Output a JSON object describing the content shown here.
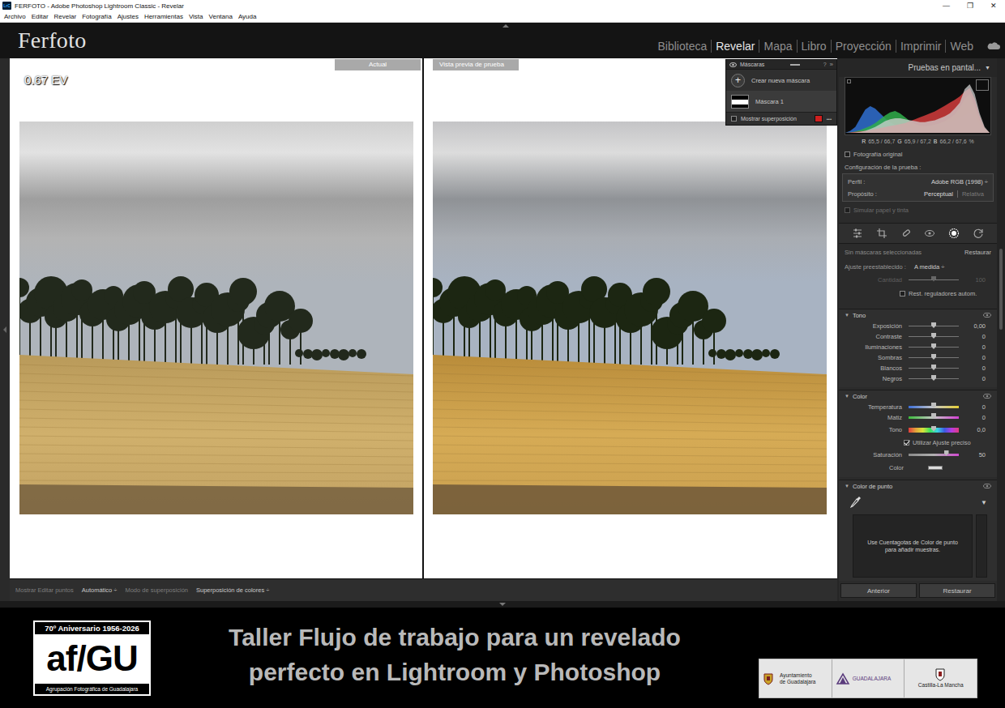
{
  "window": {
    "app_icon": "LrC",
    "title": "FERFOTO - Adobe Photoshop Lightroom Classic - Revelar",
    "controls": [
      "—",
      "❐",
      "✕"
    ]
  },
  "menu": [
    "Archivo",
    "Editar",
    "Revelar",
    "Fotografía",
    "Ajustes",
    "Herramientas",
    "Vista",
    "Ventana",
    "Ayuda"
  ],
  "identity_plate": "Ferfoto",
  "modules": [
    {
      "label": "Biblioteca",
      "selected": false
    },
    {
      "label": "Revelar",
      "selected": true
    },
    {
      "label": "Mapa",
      "selected": false
    },
    {
      "label": "Libro",
      "selected": false
    },
    {
      "label": "Proyección",
      "selected": false
    },
    {
      "label": "Imprimir",
      "selected": false
    },
    {
      "label": "Web",
      "selected": false
    }
  ],
  "compare": {
    "exposure_overlay": "0.67 EV",
    "panes": [
      {
        "label": "Actual",
        "kind": "before"
      },
      {
        "label": "Vista previa de prueba",
        "kind": "proof"
      }
    ]
  },
  "masks": {
    "title": "Máscaras",
    "help": "?",
    "expand": "»",
    "create_icon": "+",
    "create_label": "Crear nueva máscara",
    "items": [
      {
        "label": "Máscara 1",
        "selected": true
      }
    ],
    "overlay": {
      "label": "Mostrar superposición",
      "checked": false,
      "color": "#d0201f"
    },
    "more": "•••"
  },
  "toolbar": {
    "show_label": "Mostrar Editar puntos",
    "show_value": "Automático ÷",
    "mode_label": "Modo de superposición",
    "mode_value": "Superposición de colores ÷"
  },
  "right_panel": {
    "proof_header": "Pruebas en pantal...",
    "proof_menu": "▼",
    "histogram": {
      "blue": [
        0,
        4,
        12,
        30,
        48,
        55,
        50,
        40,
        30,
        22,
        16,
        12,
        10,
        9,
        9,
        10,
        12,
        14,
        16,
        18,
        20,
        22,
        26,
        30,
        35,
        40,
        30,
        15,
        5,
        0
      ],
      "green": [
        0,
        1,
        3,
        6,
        10,
        14,
        20,
        28,
        36,
        42,
        45,
        40,
        32,
        24,
        18,
        15,
        14,
        15,
        17,
        20,
        24,
        30,
        38,
        52,
        70,
        80,
        55,
        25,
        8,
        0
      ],
      "red": [
        0,
        1,
        2,
        3,
        4,
        6,
        8,
        10,
        12,
        14,
        16,
        18,
        20,
        24,
        28,
        32,
        36,
        40,
        44,
        50,
        56,
        62,
        68,
        75,
        85,
        92,
        70,
        35,
        10,
        0
      ],
      "luma": [
        0,
        0,
        1,
        2,
        4,
        8,
        12,
        18,
        24,
        28,
        30,
        30,
        28,
        26,
        24,
        22,
        22,
        24,
        26,
        30,
        34,
        40,
        50,
        62,
        90,
        100,
        80,
        40,
        12,
        0
      ]
    },
    "readout": {
      "r_label": "R",
      "r": "65,5 / 66,7",
      "g_label": "G",
      "g": "65,9 / 67,2",
      "b_label": "B",
      "b": "66,2 / 67,6",
      "unit": "%"
    },
    "original_photo": {
      "label": "Fotografía original",
      "checked": false
    },
    "proof_settings": {
      "title": "Configuración de la prueba :",
      "profile_label": "Perfil :",
      "profile_value": "Adobe RGB (1998) ÷",
      "intent_label": "Propósito :",
      "intents": [
        {
          "label": "Perceptual",
          "selected": true
        },
        {
          "label": "Relativa",
          "selected": false
        }
      ]
    },
    "simulate": {
      "label": "Simular papel y tinta",
      "checked": false,
      "disabled": true
    },
    "tools": [
      {
        "kind": "edit",
        "selected": false
      },
      {
        "kind": "crop",
        "selected": false
      },
      {
        "kind": "heal",
        "selected": false
      },
      {
        "kind": "redeye",
        "selected": false
      },
      {
        "kind": "mask",
        "selected": true
      },
      {
        "kind": "reset",
        "selected": false
      }
    ],
    "mask_status": "Sin máscaras seleccionadas",
    "mask_reset": "Restaurar",
    "preset_label": "Ajuste preestablecido :",
    "preset_value": "A medida ÷",
    "amount": {
      "kind": "slider",
      "label": "Cantidad",
      "value": "100",
      "level": 0.5,
      "disabled": true
    },
    "auto_reset": {
      "label": "Rest. reguladores autom.",
      "checked": false
    },
    "sections": [
      {
        "toggle": "▼",
        "title": "Tono",
        "expanded": true,
        "rows": [
          {
            "kind": "slider",
            "label": "Exposición",
            "value": "0,00",
            "level": 0.5
          },
          {
            "kind": "slider",
            "label": "Contraste",
            "value": "0",
            "level": 0.5
          },
          {
            "kind": "slider",
            "label": "Iluminaciones",
            "value": "0",
            "level": 0.5
          },
          {
            "kind": "slider",
            "label": "Sombras",
            "value": "0",
            "level": 0.5
          },
          {
            "kind": "slider",
            "label": "Blancos",
            "value": "0",
            "level": 0.5
          },
          {
            "kind": "slider",
            "label": "Negros",
            "value": "0",
            "level": 0.5
          }
        ]
      },
      {
        "toggle": "▼",
        "title": "Color",
        "expanded": true,
        "rows": [
          {
            "kind": "temperature",
            "label": "Temperatura",
            "value": "0",
            "level": 0.5
          },
          {
            "kind": "tint",
            "label": "Matiz",
            "value": "0",
            "level": 0.5
          },
          {
            "kind": "hue",
            "label": "Tono",
            "value": "0,0",
            "level": 0.5
          },
          {
            "kind": "checkbox",
            "label": "Utilizar Ajuste preciso",
            "checked": true
          },
          {
            "kind": "saturation",
            "label": "Saturación",
            "value": "50",
            "level": 0.75
          },
          {
            "kind": "swatch",
            "label": "Color"
          }
        ]
      }
    ],
    "point_color": {
      "toggle": "▼",
      "title": "Color de punto",
      "expanded": true,
      "menu": "▼",
      "hint": "Use Cuentagotas de Color de punto para añadir muestras."
    },
    "buttons": [
      {
        "label": "Anterior"
      },
      {
        "label": "Restaurar"
      }
    ]
  },
  "banner": {
    "logo_top": "70º Aniversario 1956-2026",
    "logo_main": "af/GU",
    "logo_bottom": "Agrupación Fotográfica de Guadalajara",
    "title_lines": [
      "Taller Flujo de trabajo para un revelado",
      "perfecto en Lightroom y Photoshop"
    ],
    "sponsors": [
      {
        "lines": [
          "Ayuntamiento",
          "de Guadalajara"
        ]
      },
      {
        "lines": [
          "GUADALAJARA"
        ]
      },
      {
        "lines": [
          "Castilla-La Mancha"
        ]
      }
    ]
  }
}
